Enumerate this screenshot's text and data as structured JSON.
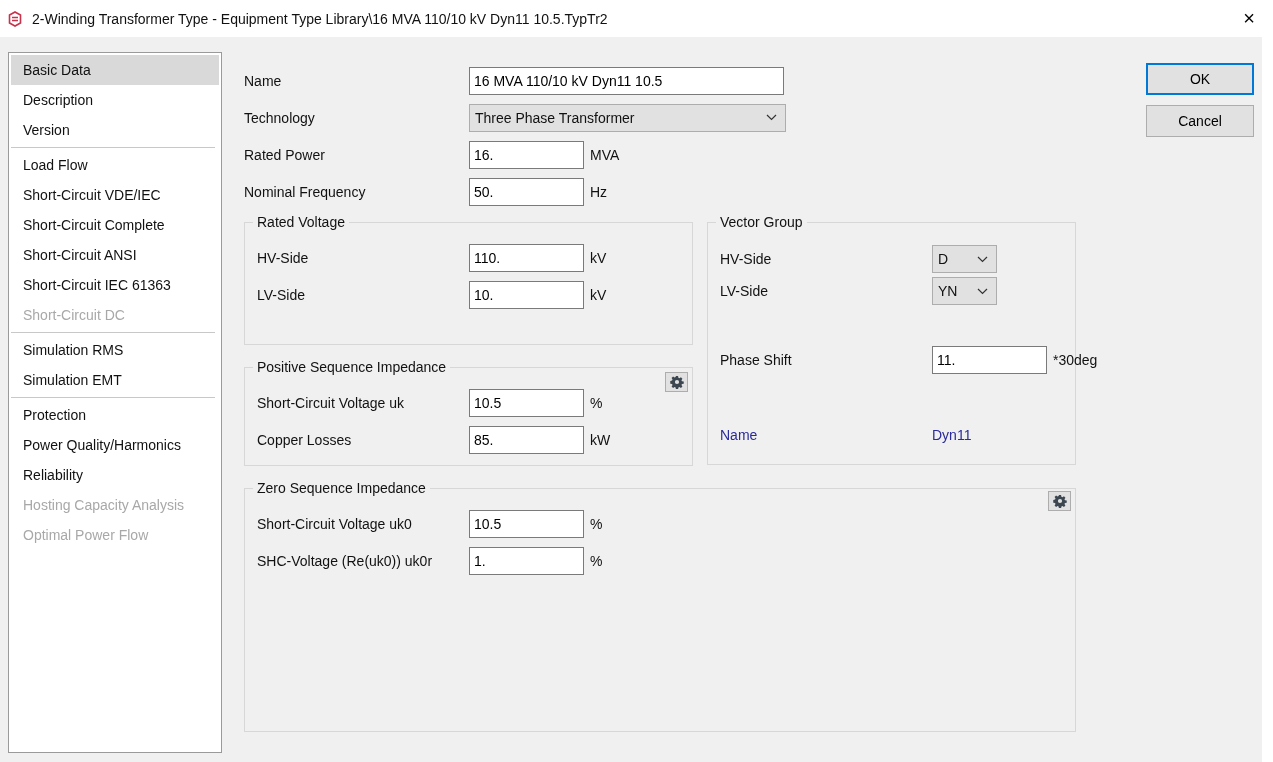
{
  "window": {
    "title": "2-Winding Transformer Type - Equipment Type Library\\16 MVA 110/10 kV Dyn11 10.5.TypTr2",
    "close": "×"
  },
  "nav_groups": [
    {
      "items": [
        {
          "label": "Basic Data",
          "selected": true,
          "disabled": false
        },
        {
          "label": "Description",
          "selected": false,
          "disabled": false
        },
        {
          "label": "Version",
          "selected": false,
          "disabled": false
        }
      ]
    },
    {
      "items": [
        {
          "label": "Load Flow",
          "selected": false,
          "disabled": false
        },
        {
          "label": "Short-Circuit VDE/IEC",
          "selected": false,
          "disabled": false
        },
        {
          "label": "Short-Circuit Complete",
          "selected": false,
          "disabled": false
        },
        {
          "label": "Short-Circuit ANSI",
          "selected": false,
          "disabled": false
        },
        {
          "label": "Short-Circuit IEC 61363",
          "selected": false,
          "disabled": false
        },
        {
          "label": "Short-Circuit DC",
          "selected": false,
          "disabled": true
        }
      ]
    },
    {
      "items": [
        {
          "label": "Simulation RMS",
          "selected": false,
          "disabled": false
        },
        {
          "label": "Simulation EMT",
          "selected": false,
          "disabled": false
        }
      ]
    },
    {
      "items": [
        {
          "label": "Protection",
          "selected": false,
          "disabled": false
        },
        {
          "label": "Power Quality/Harmonics",
          "selected": false,
          "disabled": false
        },
        {
          "label": "Reliability",
          "selected": false,
          "disabled": false
        },
        {
          "label": "Hosting Capacity Analysis",
          "selected": false,
          "disabled": true
        },
        {
          "label": "Optimal Power Flow",
          "selected": false,
          "disabled": true
        }
      ]
    }
  ],
  "top_fields": [
    {
      "kind": "wide-text",
      "label": "Name",
      "value": "16 MVA 110/10 kV Dyn11 10.5"
    },
    {
      "kind": "wide-select",
      "label": "Technology",
      "value": "Three Phase Transformer"
    },
    {
      "kind": "text",
      "label": "Rated Power",
      "value": "16.",
      "unit": "MVA"
    },
    {
      "kind": "text",
      "label": "Nominal Frequency",
      "value": "50.",
      "unit": "Hz"
    }
  ],
  "rated_voltage": {
    "title": "Rated Voltage",
    "has_settings": false,
    "rows": [
      {
        "kind": "text",
        "label": "HV-Side",
        "value": "110.",
        "unit": "kV"
      },
      {
        "kind": "text",
        "label": "LV-Side",
        "value": "10.",
        "unit": "kV"
      }
    ]
  },
  "positive_sequence": {
    "title": "Positive Sequence Impedance",
    "has_settings": true,
    "rows": [
      {
        "kind": "text",
        "label": "Short-Circuit Voltage uk",
        "value": "10.5",
        "unit": "%"
      },
      {
        "kind": "text",
        "label": "Copper Losses",
        "value": "85.",
        "unit": "kW"
      }
    ]
  },
  "vector_group": {
    "title": "Vector Group",
    "has_settings": false,
    "rows": [
      {
        "kind": "small-select",
        "label": "HV-Side",
        "value": "D"
      },
      {
        "kind": "small-select",
        "label": "LV-Side",
        "value": "YN"
      },
      {
        "kind": "text",
        "label": "Phase Shift",
        "value": "11.",
        "unit": "*30deg"
      },
      {
        "kind": "info",
        "label": "Name",
        "value": "Dyn11"
      }
    ]
  },
  "zero_sequence": {
    "title": "Zero Sequence Impedance",
    "has_settings": true,
    "rows": [
      {
        "kind": "text",
        "label": "Short-Circuit Voltage uk0",
        "value": "10.5",
        "unit": "%"
      },
      {
        "kind": "text",
        "label": "SHC-Voltage (Re(uk0)) uk0r",
        "value": "1.",
        "unit": "%"
      }
    ]
  },
  "buttons": [
    {
      "label": "OK",
      "default": true
    },
    {
      "label": "Cancel",
      "default": false
    }
  ]
}
